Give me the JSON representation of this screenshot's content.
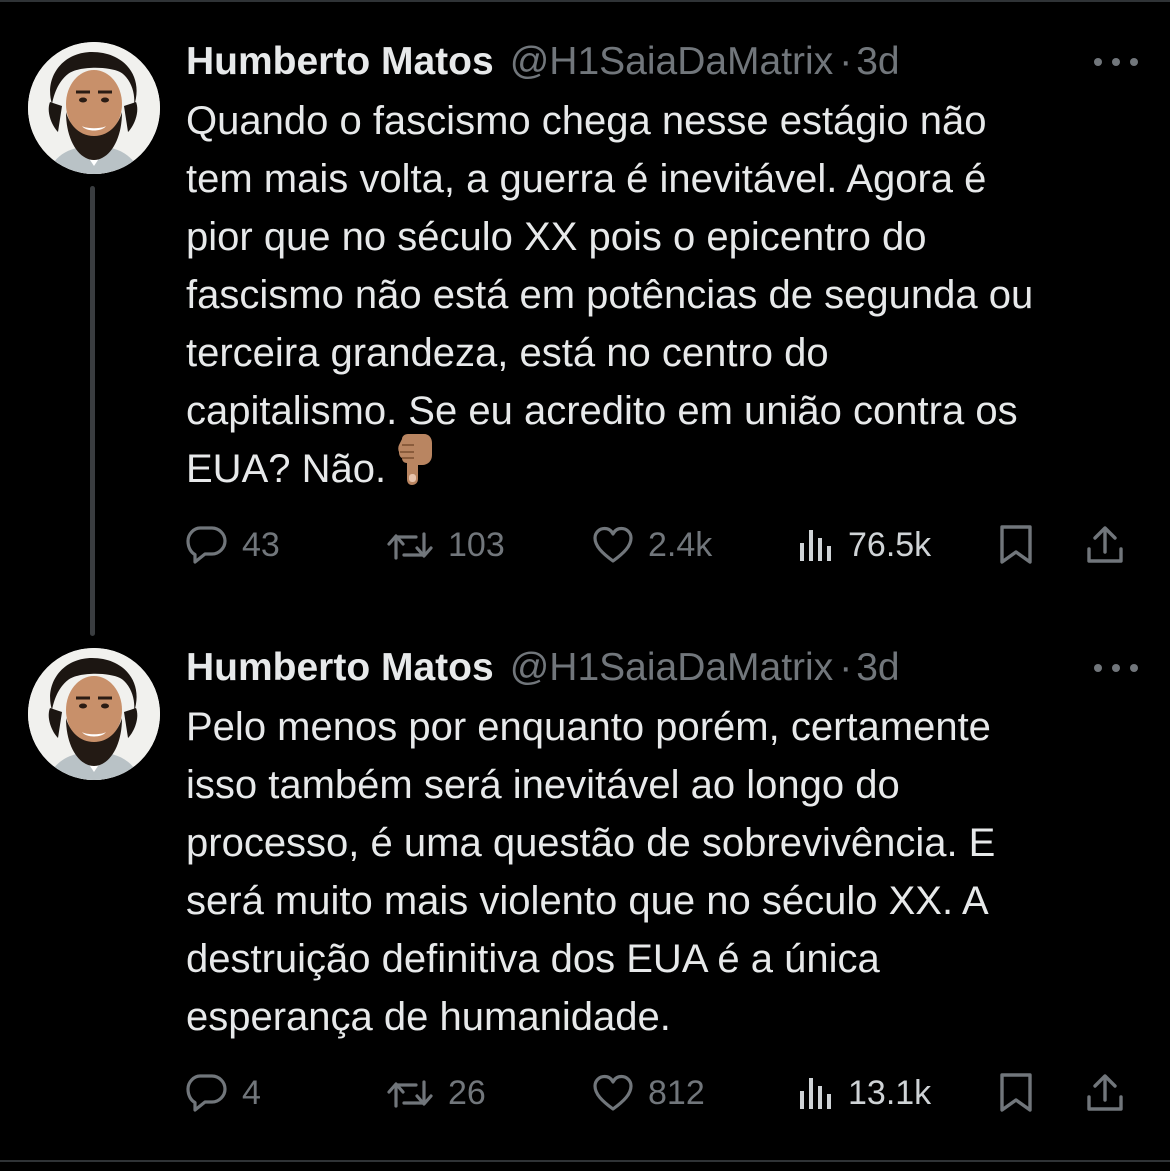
{
  "tweets": [
    {
      "author": {
        "display_name": "Humberto Matos",
        "handle": "@H1SaiaDaMatrix",
        "avatar_icon": "profile-photo"
      },
      "separator": "·",
      "time": "3d",
      "text_before_emoji": "Quando o fascismo chega nesse estágio não\ntem mais volta, a guerra é inevitável. Agora é\npior que no século XX pois o epicentro do\nfascismo não está em potências de segunda ou\nterceira grandeza, está no centro do\ncapitalismo. Se eu acredito em união contra os\nEUA? Não.",
      "emoji": "backhand-index-pointing-down",
      "stats": {
        "replies": "43",
        "retweets": "103",
        "likes": "2.4k",
        "views": "76.5k"
      }
    },
    {
      "author": {
        "display_name": "Humberto Matos",
        "handle": "@H1SaiaDaMatrix",
        "avatar_icon": "profile-photo"
      },
      "separator": "·",
      "time": "3d",
      "text": "Pelo menos por enquanto porém, certamente\nisso também será inevitável ao longo do\nprocesso, é uma questão de sobrevivência. E\nserá muito mais violento que no século XX. A\ndestruição definitiva dos EUA é a única\nesperança de humanidade.",
      "stats": {
        "replies": "4",
        "retweets": "26",
        "likes": "812",
        "views": "13.1k"
      }
    }
  ],
  "icons": {
    "reply": "reply-icon",
    "retweet": "retweet-icon",
    "like": "heart-icon",
    "views": "views-icon",
    "bookmark": "bookmark-icon",
    "share": "share-icon",
    "more": "more-icon"
  },
  "colors": {
    "background": "#000000",
    "text_primary": "#e7e9ea",
    "text_secondary": "#71767b",
    "thread_line": "#3a3d40",
    "divider": "#2f3336"
  }
}
